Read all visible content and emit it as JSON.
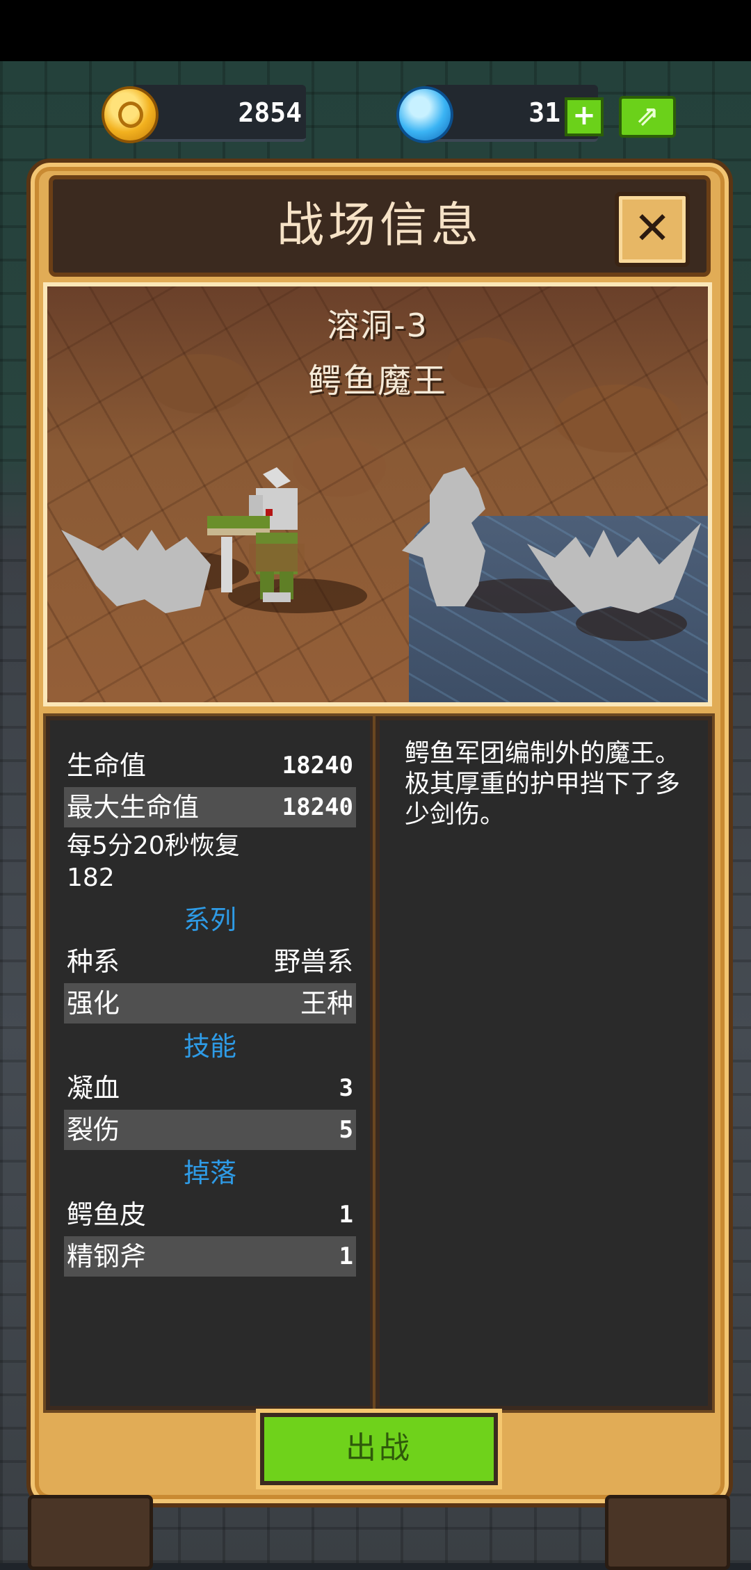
{
  "currency": {
    "gold": "2854",
    "gems": "31",
    "add_label": "+",
    "share_icon": "share-icon"
  },
  "dialog": {
    "title": "战场信息",
    "close_label": "✕"
  },
  "scene": {
    "location": "溶洞-3",
    "boss_name": "鳄鱼魔王"
  },
  "stats": {
    "hp_label": "生命值",
    "hp_value": "18240",
    "max_hp_label": "最大生命值",
    "max_hp_value": "18240",
    "regen_line1": "每5分20秒恢复",
    "regen_line2": "182",
    "series_header": "系列",
    "race_label": "种系",
    "race_value": "野兽系",
    "rank_label": "强化",
    "rank_value": "王种",
    "skills_header": "技能",
    "skills": [
      {
        "name": "凝血",
        "value": "3"
      },
      {
        "name": "裂伤",
        "value": "5"
      }
    ],
    "drops_header": "掉落",
    "drops": [
      {
        "name": "鳄鱼皮",
        "value": "1"
      },
      {
        "name": "精钢斧",
        "value": "1"
      }
    ]
  },
  "description": "鳄鱼军团编制外的魔王。极其厚重的护甲挡下了多少剑伤。",
  "go_button": "出战",
  "colors": {
    "panel": "#e1ac56",
    "section_header": "#2e9be6",
    "go_button": "#6fd21b"
  }
}
